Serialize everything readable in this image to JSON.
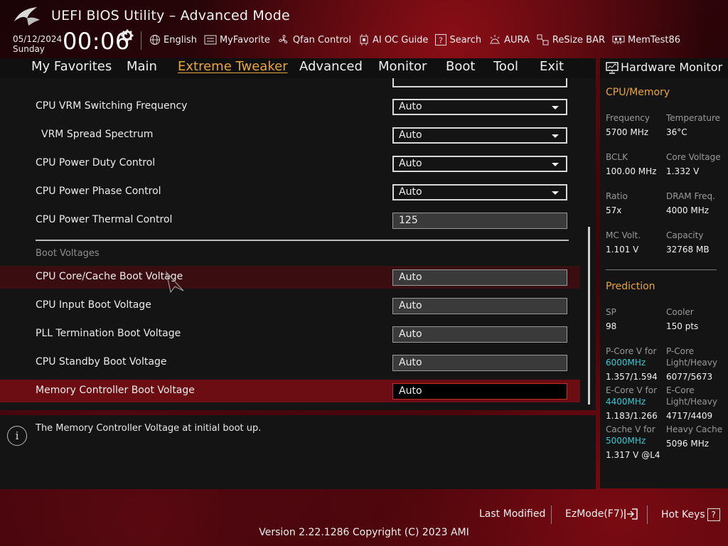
{
  "header": {
    "title": "UEFI BIOS Utility – Advanced Mode",
    "date": "05/12/2024",
    "day": "Sunday",
    "time": "00:06",
    "toolbar": [
      {
        "label": "English",
        "icon": "globe-icon"
      },
      {
        "label": "MyFavorite",
        "icon": "favorite-icon"
      },
      {
        "label": "Qfan Control",
        "icon": "fan-icon"
      },
      {
        "label": "AI OC Guide",
        "icon": "chip-icon"
      },
      {
        "label": "Search",
        "icon": "question-icon"
      },
      {
        "label": "AURA",
        "icon": "aura-light-icon"
      },
      {
        "label": "ReSize BAR",
        "icon": "resize-bar-icon"
      },
      {
        "label": "MemTest86",
        "icon": "memory-icon"
      }
    ]
  },
  "nav": {
    "tabs": [
      "My Favorites",
      "Main",
      "Extreme Tweaker",
      "Advanced",
      "Monitor",
      "Boot",
      "Tool",
      "Exit"
    ],
    "active": "Extreme Tweaker"
  },
  "settings": {
    "rows": [
      {
        "label": "CPU VRM Switching Frequency",
        "value": "Auto",
        "type": "dropdown"
      },
      {
        "label": "VRM Spread Spectrum",
        "value": "Auto",
        "type": "dropdown"
      },
      {
        "label": "CPU Power Duty Control",
        "value": "Auto",
        "type": "dropdown"
      },
      {
        "label": "CPU Power Phase Control",
        "value": "Auto",
        "type": "dropdown"
      },
      {
        "label": "CPU Power Thermal Control",
        "value": "125",
        "type": "text"
      }
    ],
    "section_title": "Boot Voltages",
    "boot_rows": [
      {
        "label": "CPU Core/Cache Boot Voltage",
        "value": "Auto"
      },
      {
        "label": "CPU Input Boot Voltage",
        "value": "Auto"
      },
      {
        "label": "PLL Termination Boot Voltage",
        "value": "Auto"
      },
      {
        "label": "CPU Standby Boot Voltage",
        "value": "Auto"
      },
      {
        "label": "Memory Controller Boot Voltage",
        "value": "Auto"
      }
    ]
  },
  "help": {
    "text": "The Memory Controller Voltage at initial boot up."
  },
  "hardware_monitor": {
    "title": "Hardware Monitor",
    "cpu_memory": {
      "title": "CPU/Memory",
      "items": [
        {
          "label": "Frequency",
          "value": "5700 MHz"
        },
        {
          "label": "Temperature",
          "value": "36°C"
        },
        {
          "label": "BCLK",
          "value": "100.00 MHz"
        },
        {
          "label": "Core Voltage",
          "value": "1.332 V"
        },
        {
          "label": "Ratio",
          "value": "57x"
        },
        {
          "label": "DRAM Freq.",
          "value": "4000 MHz"
        },
        {
          "label": "MC Volt.",
          "value": "1.101 V"
        },
        {
          "label": "Capacity",
          "value": "32768 MB"
        }
      ]
    },
    "prediction": {
      "title": "Prediction",
      "sp_label": "SP",
      "sp_value": "98",
      "cooler_label": "Cooler",
      "cooler_value": "150 pts",
      "pcore_v_label": "P-Core V for",
      "pcore_v_freq": "6000MHz",
      "pcore_v_value": "1.357/1.594",
      "pcore_lh_label1": "P-Core",
      "pcore_lh_label2": "Light/Heavy",
      "pcore_lh_value": "6077/5673",
      "ecore_v_label": "E-Core V for",
      "ecore_v_freq": "4400MHz",
      "ecore_v_value": "1.183/1.266",
      "ecore_lh_label1": "E-Core",
      "ecore_lh_label2": "Light/Heavy",
      "ecore_lh_value": "4717/4409",
      "cache_v_label": "Cache V for",
      "cache_v_freq": "5000MHz",
      "cache_v_value": "1.317 V @L4",
      "heavy_cache_label": "Heavy Cache",
      "heavy_cache_value": "5096 MHz"
    }
  },
  "footer": {
    "last_modified": "Last Modified",
    "ezmode": "EzMode(F7)",
    "hot_keys": "Hot Keys",
    "hot_keys_key": "?",
    "version": "Version 2.22.1286 Copyright (C) 2023 AMI"
  },
  "colors": {
    "accent": "#e9a63a",
    "highlight": "#38c9d4",
    "selected_row": "#6b0d12",
    "panel": "#141414"
  }
}
